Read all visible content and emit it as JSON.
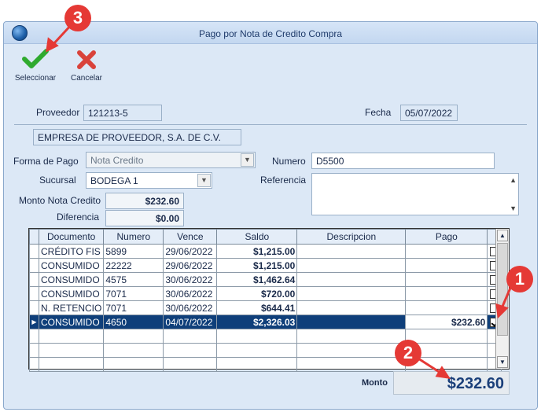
{
  "window": {
    "title": "Pago por Nota de Credito Compra"
  },
  "toolbar": {
    "select_label": "Seleccionar",
    "cancel_label": "Cancelar"
  },
  "form": {
    "proveedor_label": "Proveedor",
    "proveedor_value": "121213-5",
    "fecha_label": "Fecha",
    "fecha_value": "05/07/2022",
    "empresa_value": "EMPRESA DE PROVEEDOR, S.A. DE C.V.",
    "forma_pago_label": "Forma de Pago",
    "forma_pago_value": "Nota Credito",
    "numero_label": "Numero",
    "numero_value": "D5500",
    "sucursal_label": "Sucursal",
    "sucursal_value": "BODEGA 1",
    "referencia_label": "Referencia",
    "referencia_value": "",
    "monto_nc_label": "Monto Nota Credito",
    "monto_nc_value": "$232.60",
    "diferencia_label": "Diferencia",
    "diferencia_value": "$0.00"
  },
  "grid": {
    "columns": [
      "Documento",
      "Numero",
      "Vence",
      "Saldo",
      "Descripcion",
      "Pago"
    ],
    "rows": [
      {
        "documento": "CRÉDITO FIS",
        "numero": "5899",
        "vence": "29/06/2022",
        "saldo": "$1,215.00",
        "descripcion": "",
        "pago": "",
        "checked": false
      },
      {
        "documento": "CONSUMIDO",
        "numero": "22222",
        "vence": "29/06/2022",
        "saldo": "$1,215.00",
        "descripcion": "",
        "pago": "",
        "checked": false
      },
      {
        "documento": "CONSUMIDO",
        "numero": "4575",
        "vence": "30/06/2022",
        "saldo": "$1,462.64",
        "descripcion": "",
        "pago": "",
        "checked": false
      },
      {
        "documento": "CONSUMIDO",
        "numero": "7071",
        "vence": "30/06/2022",
        "saldo": "$720.00",
        "descripcion": "",
        "pago": "",
        "checked": false
      },
      {
        "documento": "N. RETENCIO",
        "numero": "7071",
        "vence": "30/06/2022",
        "saldo": "$644.41",
        "descripcion": "",
        "pago": "",
        "checked": false
      },
      {
        "documento": "CONSUMIDO",
        "numero": "4650",
        "vence": "04/07/2022",
        "saldo": "$2,326.03",
        "descripcion": "",
        "pago": "$232.60",
        "checked": true,
        "selected": true
      }
    ]
  },
  "footer": {
    "monto_label": "Monto",
    "monto_value": "$232.60"
  },
  "annotations": {
    "badge1": "1",
    "badge2": "2",
    "badge3": "3"
  },
  "colors": {
    "accent": "#0f3f7a",
    "badge": "#e53935",
    "window_bg": "#dce8f6"
  }
}
